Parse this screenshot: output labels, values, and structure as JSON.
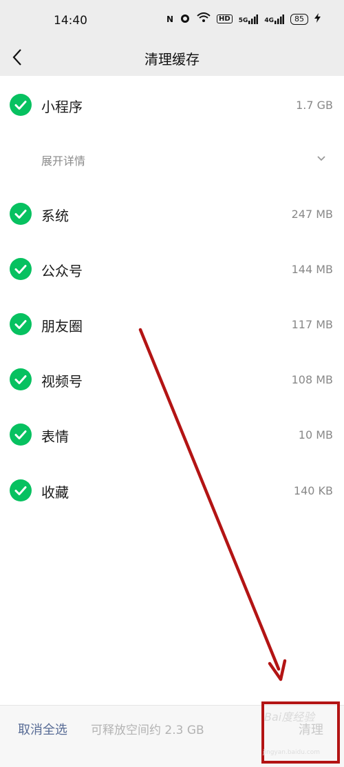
{
  "status_bar": {
    "time": "14:40",
    "nfc": "N",
    "hd": "HD",
    "net1": "5G",
    "net2": "4G",
    "battery": "85"
  },
  "nav": {
    "title": "清理缓存"
  },
  "items": [
    {
      "label": "小程序",
      "size": "1.7 GB"
    },
    {
      "label": "系统",
      "size": "247 MB"
    },
    {
      "label": "公众号",
      "size": "144 MB"
    },
    {
      "label": "朋友圈",
      "size": "117 MB"
    },
    {
      "label": "视频号",
      "size": "108 MB"
    },
    {
      "label": "表情",
      "size": "10 MB"
    },
    {
      "label": "收藏",
      "size": "140 KB"
    }
  ],
  "details": {
    "label": "展开详情"
  },
  "bottom": {
    "cancel_all": "取消全选",
    "free_space": "可释放空间约 2.3 GB",
    "clean": "清理"
  },
  "watermark": {
    "text": "Bai度经验",
    "sub": "jingyan.baidu.com"
  },
  "colors": {
    "check_green": "#07c160",
    "link_blue": "#576b95",
    "annotation_red": "#b31414"
  }
}
